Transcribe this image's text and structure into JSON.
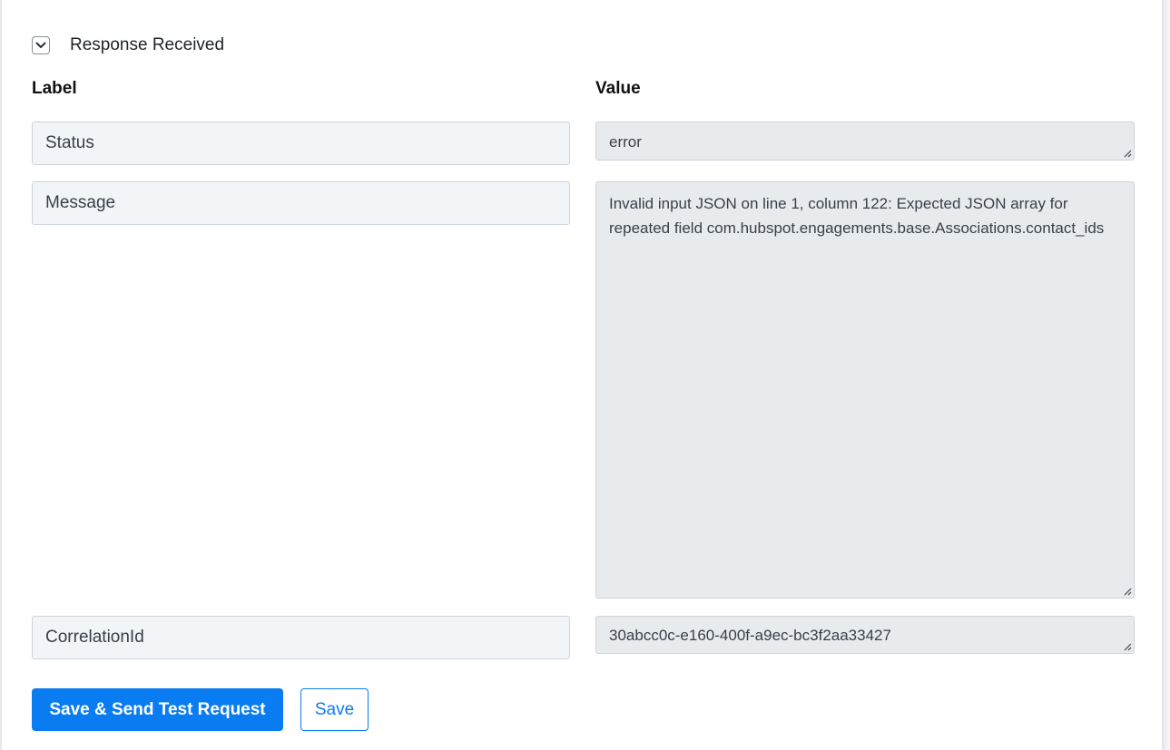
{
  "section": {
    "title": "Response Received",
    "toggle_icon": "chevron-down-icon"
  },
  "columns": {
    "label": "Label",
    "value": "Value"
  },
  "rows": [
    {
      "label": "Status",
      "value": "error"
    },
    {
      "label": "Message",
      "value": "Invalid input JSON on line 1, column 122: Expected JSON array for repeated field com.hubspot.engagements.base.Associations.contact_ids"
    },
    {
      "label": "CorrelationId",
      "value": "30abcc0c-e160-400f-a9ec-bc3f2aa33427"
    }
  ],
  "actions": {
    "save_send_label": "Save & Send Test Request",
    "save_label": "Save"
  },
  "colors": {
    "accent": "#0a7cf2",
    "label_field_bg": "#f2f5f8",
    "value_field_bg": "#e8ebee"
  }
}
